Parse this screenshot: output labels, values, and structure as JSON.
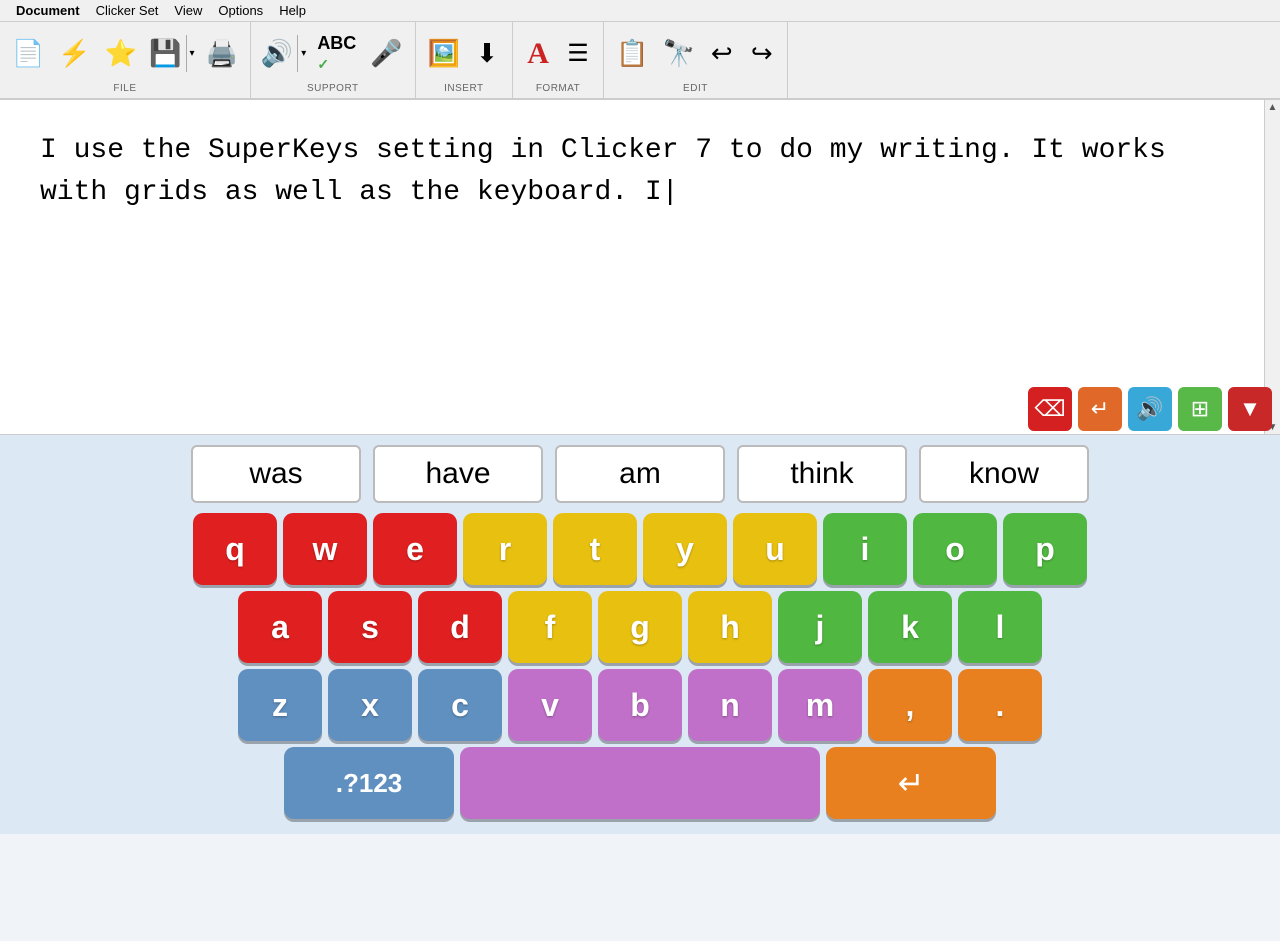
{
  "menu": {
    "items": [
      "Document",
      "Clicker Set",
      "View",
      "Options",
      "Help"
    ]
  },
  "toolbar": {
    "groups": [
      {
        "label": "FILE",
        "buttons": [
          {
            "id": "new",
            "icon": "📄",
            "label": ""
          },
          {
            "id": "open",
            "icon": "⚡",
            "label": ""
          },
          {
            "id": "bookmark",
            "icon": "⭐",
            "label": ""
          },
          {
            "id": "save",
            "icon": "💾",
            "label": ""
          },
          {
            "id": "print",
            "icon": "🖨️",
            "label": ""
          }
        ]
      },
      {
        "label": "SUPPORT",
        "buttons": [
          {
            "id": "speak",
            "icon": "🔊",
            "label": ""
          },
          {
            "id": "spellcheck",
            "icon": "ABC✓",
            "label": ""
          },
          {
            "id": "microphone",
            "icon": "🎤",
            "label": ""
          }
        ]
      },
      {
        "label": "INSERT",
        "buttons": [
          {
            "id": "image",
            "icon": "🖼️",
            "label": ""
          },
          {
            "id": "symbol",
            "icon": "↙",
            "label": ""
          }
        ]
      },
      {
        "label": "FORMAT",
        "buttons": [
          {
            "id": "font",
            "icon": "A",
            "label": ""
          },
          {
            "id": "align",
            "icon": "≡",
            "label": ""
          }
        ]
      },
      {
        "label": "EDIT",
        "buttons": [
          {
            "id": "paste",
            "icon": "📋",
            "label": ""
          },
          {
            "id": "find",
            "icon": "🔭",
            "label": ""
          },
          {
            "id": "undo",
            "icon": "↩",
            "label": ""
          },
          {
            "id": "redo",
            "icon": "↪",
            "label": ""
          }
        ]
      }
    ]
  },
  "document": {
    "text_line1": "I use the SuperKeys setting in Clicker 7 to do my writing. It works",
    "text_line2": "with grids as well as the keyboard. I"
  },
  "action_buttons": [
    {
      "id": "backspace",
      "color": "#d42020",
      "icon": "⌫"
    },
    {
      "id": "return",
      "color": "#e06828",
      "icon": "↵"
    },
    {
      "id": "speak2",
      "color": "#38a8d8",
      "icon": "🔊"
    },
    {
      "id": "grid",
      "color": "#58b848",
      "icon": "⊞"
    },
    {
      "id": "down",
      "color": "#c82828",
      "icon": "▼"
    }
  ],
  "word_suggestions": [
    "was",
    "have",
    "am",
    "think",
    "know"
  ],
  "keyboard": {
    "rows": [
      {
        "keys": [
          {
            "char": "q",
            "color": "key-red"
          },
          {
            "char": "w",
            "color": "key-red"
          },
          {
            "char": "e",
            "color": "key-red"
          },
          {
            "char": "r",
            "color": "key-yellow"
          },
          {
            "char": "t",
            "color": "key-yellow"
          },
          {
            "char": "y",
            "color": "key-yellow"
          },
          {
            "char": "u",
            "color": "key-yellow"
          },
          {
            "char": "i",
            "color": "key-green"
          },
          {
            "char": "o",
            "color": "key-green"
          },
          {
            "char": "p",
            "color": "key-green"
          }
        ]
      },
      {
        "keys": [
          {
            "char": "a",
            "color": "key-red"
          },
          {
            "char": "s",
            "color": "key-red"
          },
          {
            "char": "d",
            "color": "key-red"
          },
          {
            "char": "f",
            "color": "key-yellow"
          },
          {
            "char": "g",
            "color": "key-yellow"
          },
          {
            "char": "h",
            "color": "key-yellow"
          },
          {
            "char": "j",
            "color": "key-green"
          },
          {
            "char": "k",
            "color": "key-green"
          },
          {
            "char": "l",
            "color": "key-green"
          }
        ]
      },
      {
        "keys": [
          {
            "char": "z",
            "color": "key-blue"
          },
          {
            "char": "x",
            "color": "key-blue"
          },
          {
            "char": "c",
            "color": "key-blue"
          },
          {
            "char": "v",
            "color": "key-purple"
          },
          {
            "char": "b",
            "color": "key-purple"
          },
          {
            "char": "n",
            "color": "key-purple"
          },
          {
            "char": "m",
            "color": "key-purple"
          },
          {
            "char": ",",
            "color": "key-orange"
          },
          {
            "char": ".",
            "color": "key-orange"
          }
        ]
      }
    ],
    "bottom_left": ".?123",
    "enter_icon": "↵"
  }
}
